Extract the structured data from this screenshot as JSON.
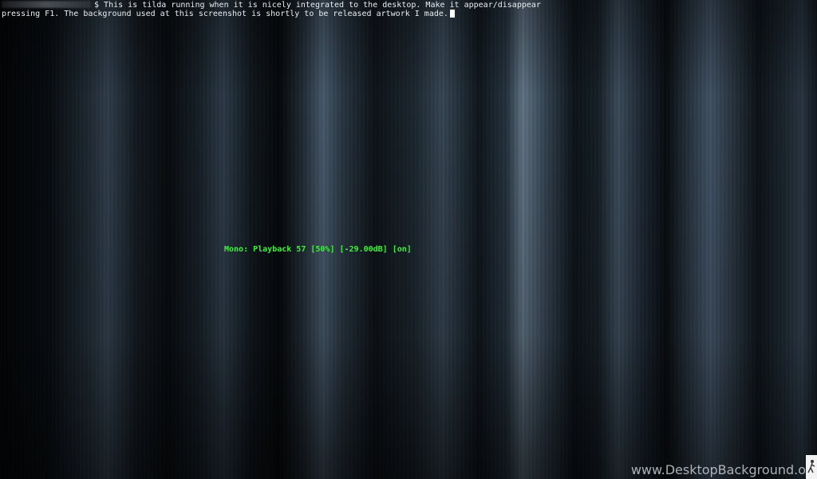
{
  "terminal": {
    "app": "tilda",
    "prompt_symbol": "$",
    "line1": " This is tilda running when it is nicely integrated to the desktop. Make it appear/disappear",
    "line2": "pressing F1. The background used at this screenshot is shortly to be released artwork I made."
  },
  "osd": {
    "volume_text": "Mono: Playback 57 [50%] [-29.00dB] [on]",
    "color": "#3df23a"
  },
  "watermark": {
    "text": "www.DesktopBackground.o",
    "icon": "figure-icon"
  },
  "colors": {
    "terminal_text": "#e8eef2",
    "cursor": "#ffffff"
  }
}
